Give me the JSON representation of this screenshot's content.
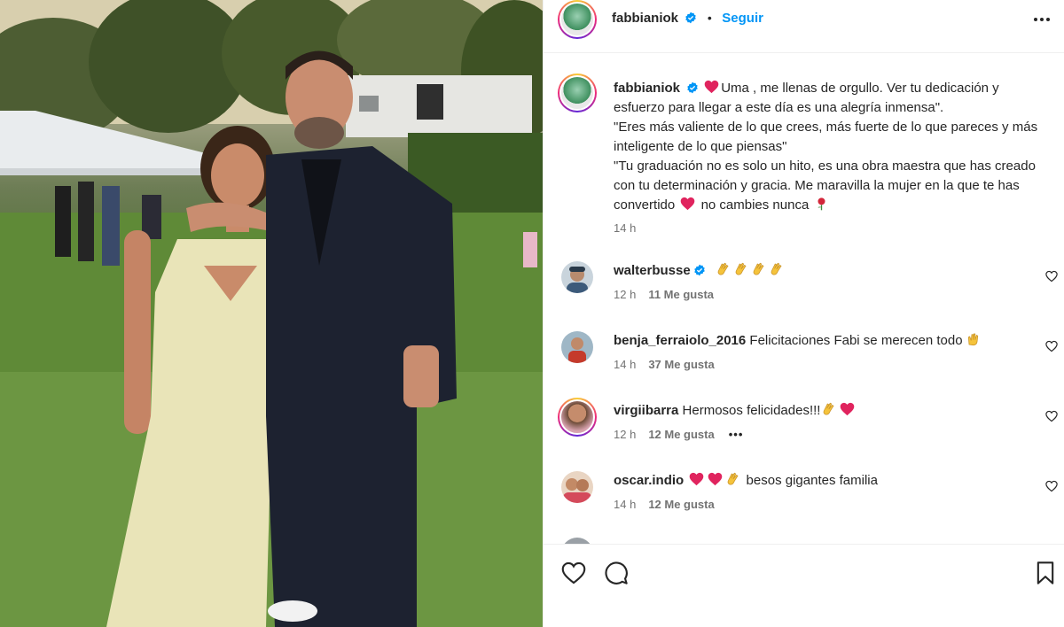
{
  "post": {
    "username": "fabbianiok",
    "follow_label": "Seguir",
    "separator": "•"
  },
  "caption": {
    "username": "fabbianiok",
    "line1": "Uma , me llenas de orgullo. Ver tu dedicación y esfuerzo para llegar a este día es una alegría inmensa\".",
    "line2": "\"Eres más valiente de lo que crees, más fuerte de lo que pareces y más inteligente de lo que piensas\"",
    "line3a": "\"Tu graduación no es solo un hito, es una obra maestra que has creado con tu determinación y gracia. Me maravilla la mujer en la que te has convertido",
    "line3b": "no cambies nunca",
    "time": "14 h"
  },
  "comments": [
    {
      "username": "walterbusse",
      "text": "",
      "time": "12 h",
      "likes": "11 Me gusta",
      "verified": true
    },
    {
      "username": "benja_ferraiolo_2016",
      "text": "Felicitaciones Fabi se merecen todo",
      "time": "14 h",
      "likes": "37 Me gusta"
    },
    {
      "username": "virgiibarra",
      "text": "Hermosos felicidades!!!",
      "time": "12 h",
      "likes": "12 Me gusta",
      "more": "•••"
    },
    {
      "username": "oscar.indio",
      "text": "besos gigantes familia",
      "time": "14 h",
      "likes": "12 Me gusta"
    }
  ],
  "icons": {
    "verified": "verified-badge-icon",
    "like": "heart-icon",
    "comment": "comment-icon",
    "save": "bookmark-icon",
    "more": "more-options-icon"
  },
  "colors": {
    "accent": "#0095f6",
    "text": "#262626",
    "muted": "#737373",
    "heart_red": "#e0245e"
  }
}
